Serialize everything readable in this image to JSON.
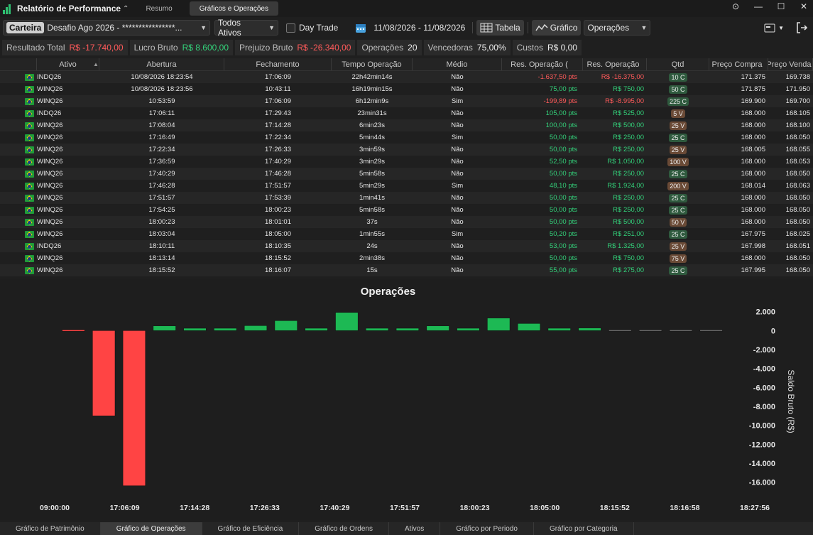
{
  "app": {
    "title": "Relatório de Performance",
    "tabs": [
      "Resumo",
      "Gráficos e Operações"
    ],
    "active_tab": 1
  },
  "toolbar": {
    "carteira_chip": "Carteira",
    "account_value": "Desafio Ago 2026 - ****************...",
    "assets_value": "Todos Ativos",
    "day_trade_label": "Day Trade",
    "date_range": "11/08/2026 - 11/08/2026",
    "tabela_label": "Tabela",
    "grafico_label": "Gráfico",
    "view_value": "Operações"
  },
  "summary": [
    {
      "label": "Resultado Total",
      "value": "R$ -17.740,00",
      "tone": "neg"
    },
    {
      "label": "Lucro Bruto",
      "value": "R$ 8.600,00",
      "tone": "pos"
    },
    {
      "label": "Prejuizo Bruto",
      "value": "R$ -26.340,00",
      "tone": "neg"
    },
    {
      "label": "Operações",
      "value": "20",
      "tone": "wht"
    },
    {
      "label": "Vencedoras",
      "value": "75,00%",
      "tone": "wht"
    },
    {
      "label": "Custos",
      "value": "R$ 0,00",
      "tone": "wht"
    }
  ],
  "table": {
    "headers": [
      "Ativo",
      "Abertura",
      "Fechamento",
      "Tempo Operação",
      "Médio",
      "Res. Operação (",
      "Res. Operação",
      "Qtd",
      "Preço Compra",
      "Preço Venda"
    ],
    "rows": [
      [
        "INDQ26",
        "10/08/2026 18:23:54",
        "17:06:09",
        "22h42min14s",
        "Não",
        "-1.637,50 pts",
        "R$ -16.375,00",
        "10 C",
        "171.375",
        "169.738"
      ],
      [
        "WINQ26",
        "10/08/2026 18:23:56",
        "10:43:11",
        "16h19min15s",
        "Não",
        "75,00 pts",
        "R$ 750,00",
        "50 C",
        "171.875",
        "171.950"
      ],
      [
        "WINQ26",
        "10:53:59",
        "17:06:09",
        "6h12min9s",
        "Sim",
        "-199,89 pts",
        "R$ -8.995,00",
        "225 C",
        "169.900",
        "169.700"
      ],
      [
        "INDQ26",
        "17:06:11",
        "17:29:43",
        "23min31s",
        "Não",
        "105,00 pts",
        "R$ 525,00",
        "5 V",
        "168.000",
        "168.105"
      ],
      [
        "WINQ26",
        "17:08:04",
        "17:14:28",
        "6min23s",
        "Não",
        "100,00 pts",
        "R$ 500,00",
        "25 V",
        "168.000",
        "168.100"
      ],
      [
        "WINQ26",
        "17:16:49",
        "17:22:34",
        "5min44s",
        "Sim",
        "50,00 pts",
        "R$ 250,00",
        "25 C",
        "168.000",
        "168.050"
      ],
      [
        "WINQ26",
        "17:22:34",
        "17:26:33",
        "3min59s",
        "Não",
        "50,00 pts",
        "R$ 250,00",
        "25 V",
        "168.005",
        "168.055"
      ],
      [
        "WINQ26",
        "17:36:59",
        "17:40:29",
        "3min29s",
        "Não",
        "52,50 pts",
        "R$ 1.050,00",
        "100 V",
        "168.000",
        "168.053"
      ],
      [
        "WINQ26",
        "17:40:29",
        "17:46:28",
        "5min58s",
        "Não",
        "50,00 pts",
        "R$ 250,00",
        "25 C",
        "168.000",
        "168.050"
      ],
      [
        "WINQ26",
        "17:46:28",
        "17:51:57",
        "5min29s",
        "Sim",
        "48,10 pts",
        "R$ 1.924,00",
        "200 V",
        "168.014",
        "168.063"
      ],
      [
        "WINQ26",
        "17:51:57",
        "17:53:39",
        "1min41s",
        "Não",
        "50,00 pts",
        "R$ 250,00",
        "25 C",
        "168.000",
        "168.050"
      ],
      [
        "WINQ26",
        "17:54:25",
        "18:00:23",
        "5min58s",
        "Não",
        "50,00 pts",
        "R$ 250,00",
        "25 C",
        "168.000",
        "168.050"
      ],
      [
        "WINQ26",
        "18:00:23",
        "18:01:01",
        "37s",
        "Não",
        "50,00 pts",
        "R$ 500,00",
        "50 V",
        "168.000",
        "168.050"
      ],
      [
        "WINQ26",
        "18:03:04",
        "18:05:00",
        "1min55s",
        "Sim",
        "50,20 pts",
        "R$ 251,00",
        "25 C",
        "167.975",
        "168.025"
      ],
      [
        "INDQ26",
        "18:10:11",
        "18:10:35",
        "24s",
        "Não",
        "53,00 pts",
        "R$ 1.325,00",
        "25 V",
        "167.998",
        "168.051"
      ],
      [
        "WINQ26",
        "18:13:14",
        "18:15:52",
        "2min38s",
        "Não",
        "50,00 pts",
        "R$ 750,00",
        "75 V",
        "168.000",
        "168.050"
      ],
      [
        "WINQ26",
        "18:15:52",
        "18:16:07",
        "15s",
        "Não",
        "55,00 pts",
        "R$ 275,00",
        "25 C",
        "167.995",
        "168.050"
      ]
    ]
  },
  "chart_data": {
    "type": "bar",
    "title": "Operações",
    "ylabel": "Saldo Bruto (R$)",
    "ylim": [
      -17000,
      2500
    ],
    "yticks": [
      "2.000",
      "0",
      "-2.000",
      "-4.000",
      "-6.000",
      "-8.000",
      "-10.000",
      "-12.000",
      "-14.000",
      "-16.000"
    ],
    "ytick_values": [
      2000,
      0,
      -2000,
      -4000,
      -6000,
      -8000,
      -10000,
      -12000,
      -14000,
      -16000
    ],
    "xticks": [
      "09:00:00",
      "17:06:09",
      "17:14:28",
      "17:26:33",
      "17:40:29",
      "17:51:57",
      "18:00:23",
      "18:05:00",
      "18:15:52",
      "18:16:58",
      "18:27:56"
    ],
    "values": [
      -100,
      -8995,
      -16375,
      500,
      250,
      250,
      525,
      1050,
      250,
      1924,
      250,
      250,
      500,
      250,
      1325,
      750,
      250,
      275,
      0,
      0,
      0,
      0
    ],
    "colors": {
      "positive": "#1db954",
      "negative": "#ff4444",
      "zero": "#6a6a6a"
    }
  },
  "bottom_tabs": [
    "Gráfico de Patrimônio",
    "Gráfico de Operações",
    "Gráfico de Eficiência",
    "Gráfico de Ordens",
    "Ativos",
    "Gráfico por Periodo",
    "Gráfico por Categoria"
  ],
  "bottom_active": 1
}
